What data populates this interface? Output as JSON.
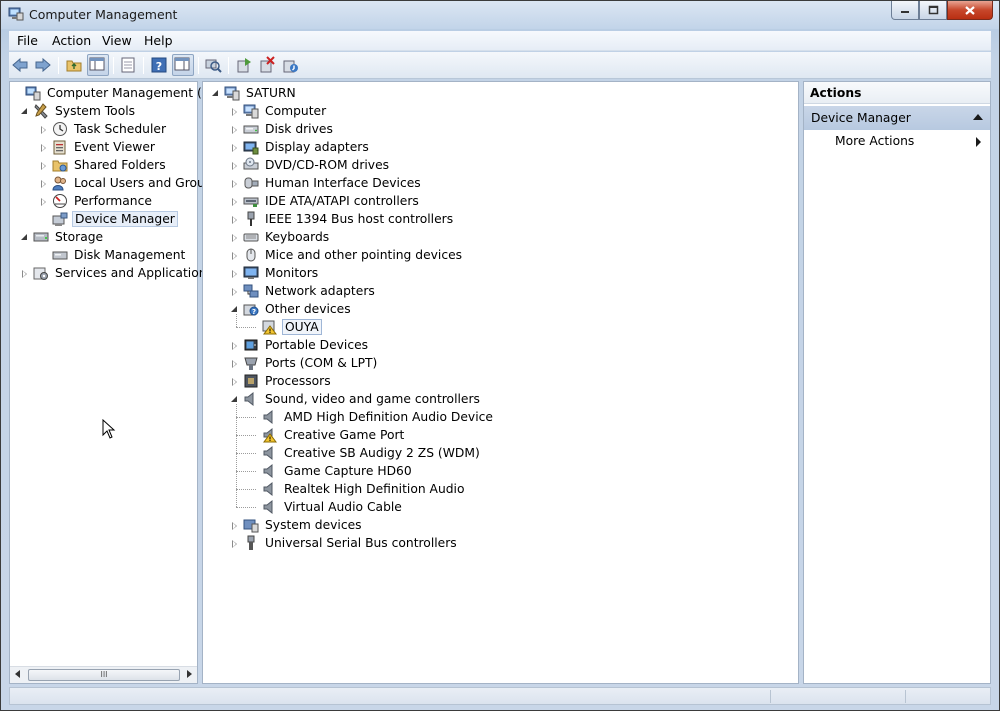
{
  "window": {
    "title": "Computer Management"
  },
  "menu": [
    "File",
    "Action",
    "View",
    "Help"
  ],
  "left_tree": [
    {
      "label": "Computer Management (Local",
      "level": 0,
      "state": "none",
      "icon": "computer-management-icon"
    },
    {
      "label": "System Tools",
      "level": 1,
      "state": "open",
      "icon": "system-tools-icon"
    },
    {
      "label": "Task Scheduler",
      "level": 2,
      "state": "closed",
      "icon": "clock-icon"
    },
    {
      "label": "Event Viewer",
      "level": 2,
      "state": "closed",
      "icon": "event-viewer-icon"
    },
    {
      "label": "Shared Folders",
      "level": 2,
      "state": "closed",
      "icon": "shared-folder-icon"
    },
    {
      "label": "Local Users and Groups",
      "level": 2,
      "state": "closed",
      "icon": "users-icon"
    },
    {
      "label": "Performance",
      "level": 2,
      "state": "closed",
      "icon": "performance-icon"
    },
    {
      "label": "Device Manager",
      "level": 2,
      "state": "none",
      "icon": "device-manager-icon",
      "selected": true
    },
    {
      "label": "Storage",
      "level": 1,
      "state": "open",
      "icon": "storage-icon"
    },
    {
      "label": "Disk Management",
      "level": 2,
      "state": "none",
      "icon": "disk-icon"
    },
    {
      "label": "Services and Applications",
      "level": 1,
      "state": "closed",
      "icon": "services-icon"
    }
  ],
  "scrollbar_grip": "III",
  "device_tree": {
    "root": "SATURN",
    "items": [
      {
        "label": "Computer",
        "state": "closed",
        "icon": "computer-icon"
      },
      {
        "label": "Disk drives",
        "state": "closed",
        "icon": "disk-drive-icon"
      },
      {
        "label": "Display adapters",
        "state": "closed",
        "icon": "display-adapter-icon"
      },
      {
        "label": "DVD/CD-ROM drives",
        "state": "closed",
        "icon": "dvd-icon"
      },
      {
        "label": "Human Interface Devices",
        "state": "closed",
        "icon": "hid-icon"
      },
      {
        "label": "IDE ATA/ATAPI controllers",
        "state": "closed",
        "icon": "ide-icon"
      },
      {
        "label": "IEEE 1394 Bus host controllers",
        "state": "closed",
        "icon": "firewire-icon"
      },
      {
        "label": "Keyboards",
        "state": "closed",
        "icon": "keyboard-icon"
      },
      {
        "label": "Mice and other pointing devices",
        "state": "closed",
        "icon": "mouse-icon"
      },
      {
        "label": "Monitors",
        "state": "closed",
        "icon": "monitor-icon"
      },
      {
        "label": "Network adapters",
        "state": "closed",
        "icon": "network-icon"
      },
      {
        "label": "Other devices",
        "state": "open",
        "icon": "unknown-device-icon",
        "children": [
          {
            "label": "OUYA",
            "icon": "warning-device-icon",
            "focused": true
          }
        ]
      },
      {
        "label": "Portable Devices",
        "state": "closed",
        "icon": "portable-device-icon"
      },
      {
        "label": "Ports (COM & LPT)",
        "state": "closed",
        "icon": "port-icon"
      },
      {
        "label": "Processors",
        "state": "closed",
        "icon": "processor-icon"
      },
      {
        "label": "Sound, video and game controllers",
        "state": "open",
        "icon": "speaker-icon",
        "children": [
          {
            "label": "AMD High Definition Audio Device",
            "icon": "speaker-icon"
          },
          {
            "label": "Creative Game Port",
            "icon": "warning-speaker-icon"
          },
          {
            "label": "Creative SB Audigy 2 ZS (WDM)",
            "icon": "speaker-icon"
          },
          {
            "label": "Game Capture HD60",
            "icon": "speaker-icon"
          },
          {
            "label": "Realtek High Definition Audio",
            "icon": "speaker-icon"
          },
          {
            "label": "Virtual Audio Cable",
            "icon": "speaker-icon"
          }
        ]
      },
      {
        "label": "System devices",
        "state": "closed",
        "icon": "system-device-icon"
      },
      {
        "label": "Universal Serial Bus controllers",
        "state": "closed",
        "icon": "usb-icon"
      }
    ]
  },
  "actions": {
    "header": "Actions",
    "section": "Device Manager",
    "items": [
      "More Actions"
    ]
  }
}
